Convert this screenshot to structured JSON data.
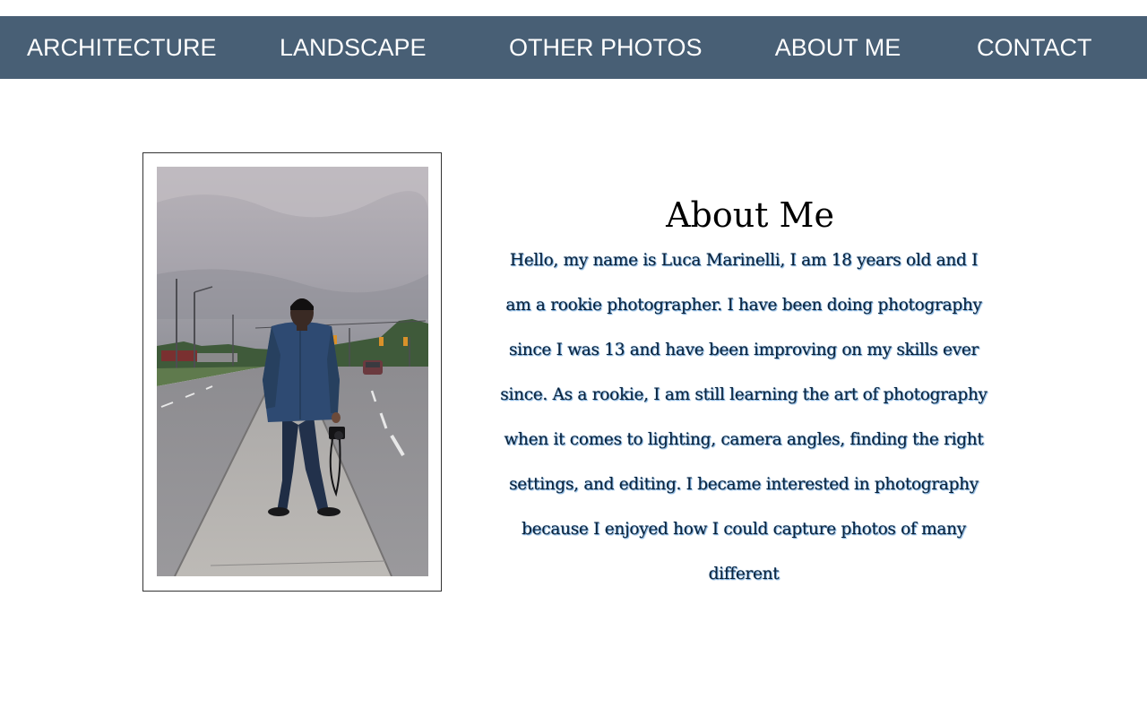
{
  "nav": {
    "items": [
      {
        "label": "ARCHITECTURE"
      },
      {
        "label": "LANDSCAPE"
      },
      {
        "label": "OTHER PHOTOS"
      },
      {
        "label": "ABOUT ME"
      },
      {
        "label": "CONTACT"
      }
    ],
    "background_color": "#485f75",
    "text_color": "#ffffff"
  },
  "about": {
    "title": "About Me",
    "body": "Hello, my name is Luca Marinelli, I am 18 years old and I am a rookie photographer. I have been doing photography since I was 13 and have been improving on my skills ever since. As a rookie, I am still learning the art of photography when it comes to lighting, camera angles, finding the right settings, and editing. I became interested in photography because I enjoyed how I could capture photos of many different"
  },
  "photo": {
    "icon": "portrait-photo"
  }
}
